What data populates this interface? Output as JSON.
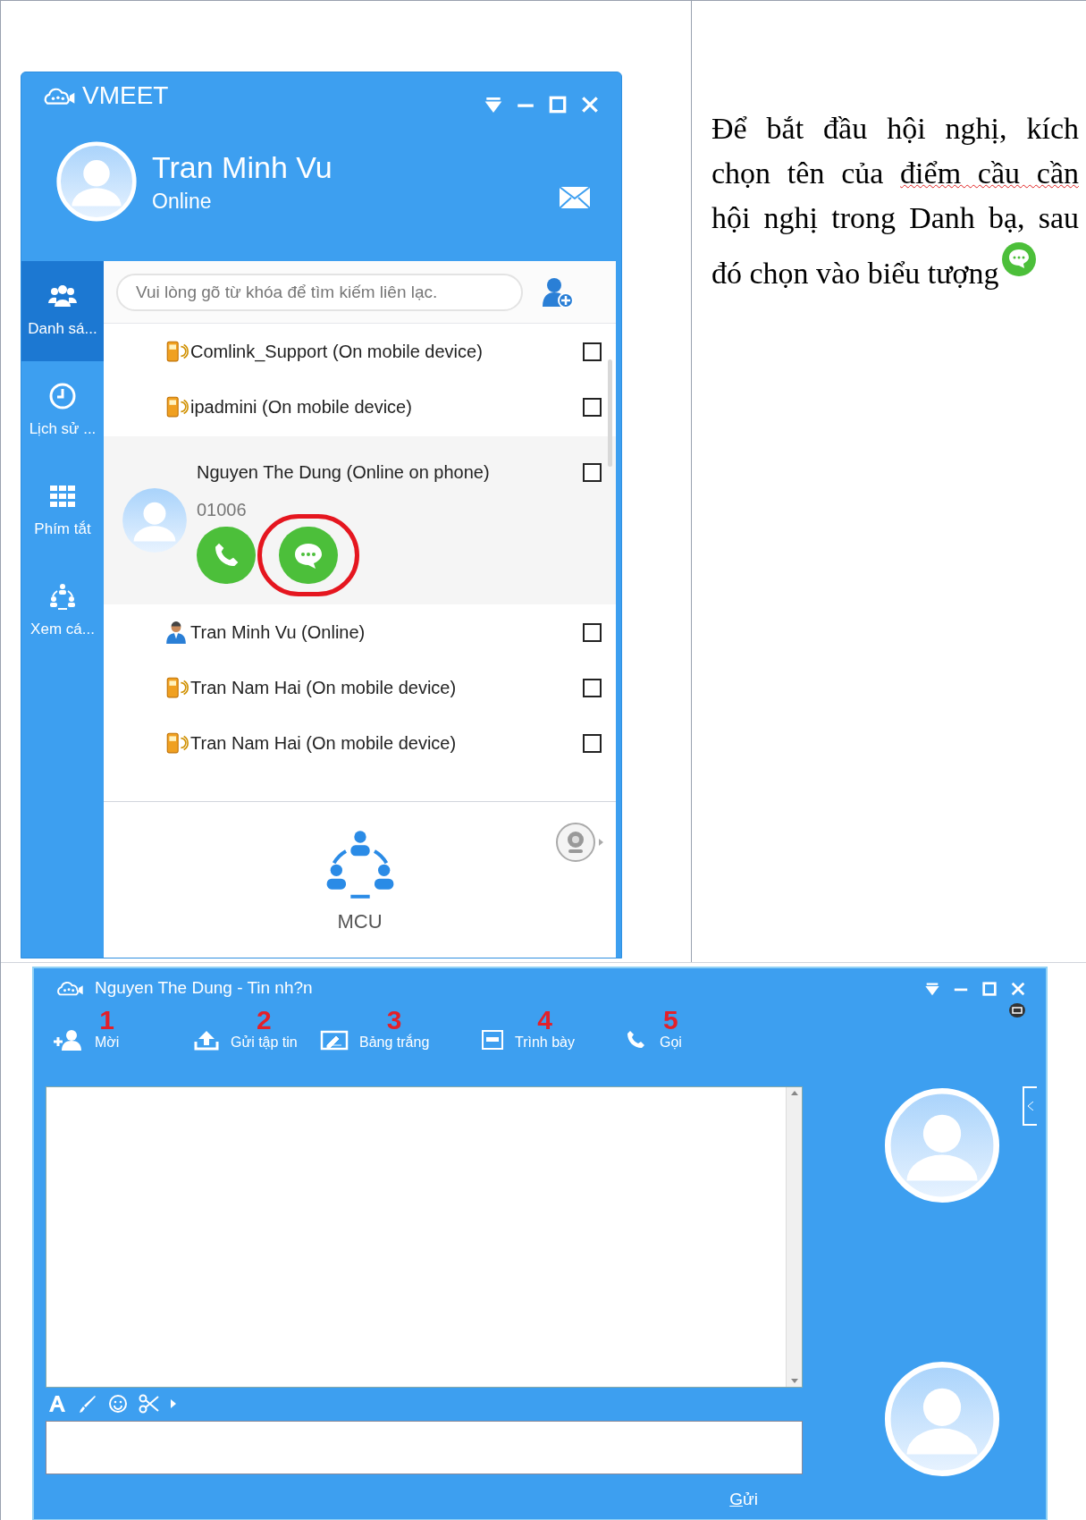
{
  "contacts_window": {
    "title": "VMEET",
    "user": {
      "name": "Tran Minh Vu",
      "status": "Online"
    },
    "sidebar": [
      {
        "label": "Danh sá...",
        "selected": true
      },
      {
        "label": "Lịch sử ...",
        "selected": false
      },
      {
        "label": "Phím tắt",
        "selected": false
      },
      {
        "label": "Xem cá...",
        "selected": false
      }
    ],
    "search": {
      "placeholder": "Vui lòng gõ từ khóa để tìm kiếm liên lạc."
    },
    "contacts": [
      {
        "kind": "mobile",
        "name": "Comlink_Support (On mobile device)",
        "checked": false
      },
      {
        "kind": "mobile",
        "name": "ipadmini (On mobile device)",
        "checked": false
      },
      {
        "kind": "expanded",
        "name": "Nguyen The Dung (Online on phone)",
        "number": "01006",
        "checked": false,
        "highlighted": true
      },
      {
        "kind": "user",
        "name": "Tran Minh Vu (Online)",
        "checked": false
      },
      {
        "kind": "mobile",
        "name": "Tran Nam Hai (On mobile device)",
        "checked": false
      },
      {
        "kind": "mobile",
        "name": "Tran Nam Hai (On mobile device)",
        "checked": false
      }
    ],
    "mcu_label": "MCU"
  },
  "instruction": [
    {
      "text": "Để bắt đầu hội nghị, kích chọn tên của ",
      "flagged": false
    },
    {
      "text": "điểm cầu cần",
      "flagged": true
    },
    {
      "text": " hội nghị trong Danh bạ, sau đó chọn vào biểu tượng",
      "flagged": false
    }
  ],
  "chat_window": {
    "title": "Nguyen The Dung - Tin nh?n",
    "toolbar": [
      {
        "number": "1",
        "label": "Mời"
      },
      {
        "number": "2",
        "label": "Gửi tập tin"
      },
      {
        "number": "3",
        "label": "Bảng trắng"
      },
      {
        "number": "4",
        "label": "Trình bày"
      },
      {
        "number": "5",
        "label": "Gọi"
      }
    ],
    "send_label": "Gửi"
  }
}
